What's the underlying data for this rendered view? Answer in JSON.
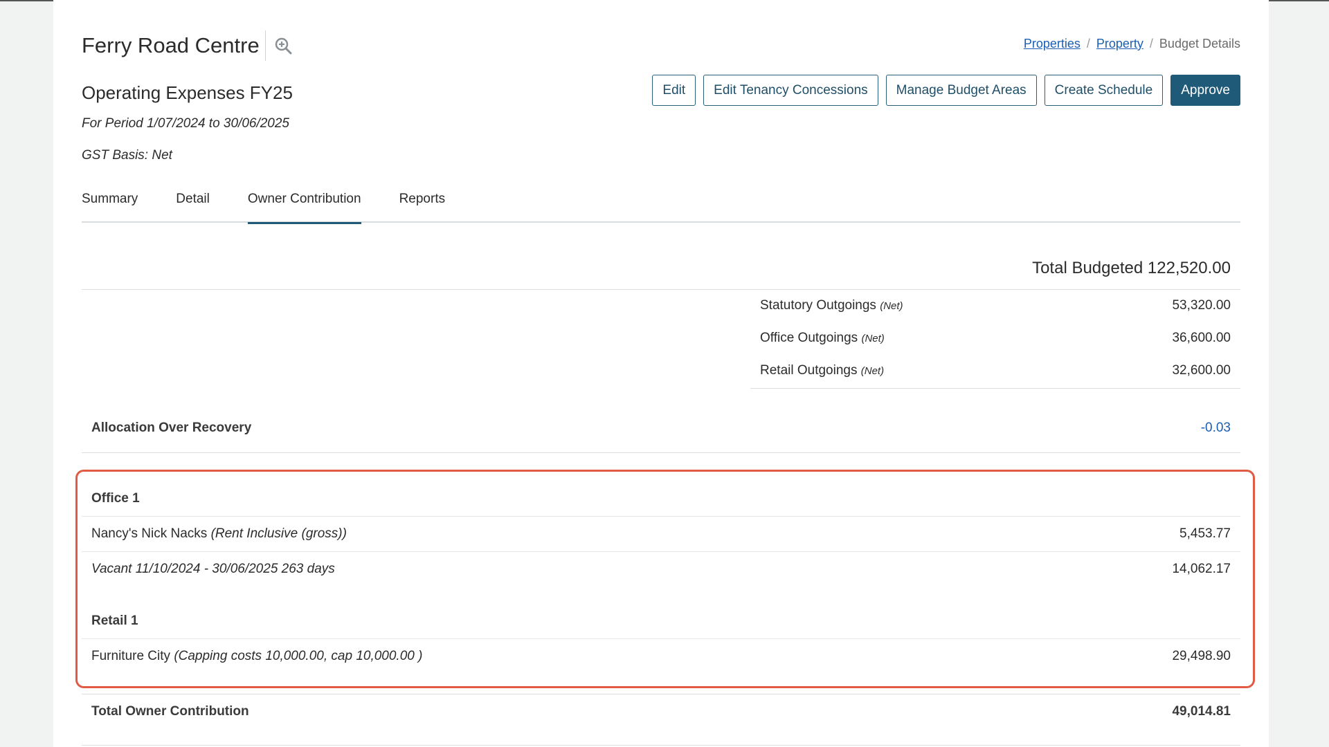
{
  "property": {
    "name": "Ferry Road Centre",
    "zoom_icon": "zoom-in-icon"
  },
  "breadcrumb": {
    "items": [
      "Properties",
      "Property"
    ],
    "current": "Budget Details",
    "separator": "/"
  },
  "budget": {
    "title": "Operating Expenses FY25",
    "period": "For Period 1/07/2024 to 30/06/2025",
    "gst_basis": "GST Basis: Net"
  },
  "actions": {
    "edit": "Edit",
    "edit_tenancy": "Edit Tenancy Concessions",
    "manage_areas": "Manage Budget Areas",
    "create_schedule": "Create Schedule",
    "approve": "Approve"
  },
  "tabs": [
    {
      "label": "Summary"
    },
    {
      "label": "Detail"
    },
    {
      "label": "Owner Contribution",
      "active": true
    },
    {
      "label": "Reports"
    }
  ],
  "totals": {
    "total_budgeted": "Total Budgeted 122,520.00",
    "lines": [
      {
        "label": "Statutory Outgoings",
        "basis": "(Net)",
        "amount": "53,320.00"
      },
      {
        "label": "Office Outgoings",
        "basis": "(Net)",
        "amount": "36,600.00"
      },
      {
        "label": "Retail Outgoings",
        "basis": "(Net)",
        "amount": "32,600.00"
      }
    ]
  },
  "allocation": {
    "label": "Allocation Over Recovery",
    "value": "-0.03"
  },
  "owner_groups": [
    {
      "area": "Office 1",
      "rows": [
        {
          "name": "Nancy's Nick Nacks",
          "note": "(Rent Inclusive (gross))",
          "amount": "5,453.77"
        },
        {
          "name": "",
          "note": "Vacant 11/10/2024 - 30/06/2025 263 days",
          "amount": "14,062.17"
        }
      ]
    },
    {
      "area": "Retail 1",
      "rows": [
        {
          "name": "Furniture City",
          "note": "(Capping costs 10,000.00, cap 10,000.00 )",
          "amount": "29,498.90"
        }
      ]
    }
  ],
  "total_owner": {
    "label": "Total Owner Contribution",
    "value": "49,014.81"
  },
  "colors": {
    "accent": "#1f5a78",
    "link": "#1a5fb4",
    "highlight": "#e05a44"
  }
}
